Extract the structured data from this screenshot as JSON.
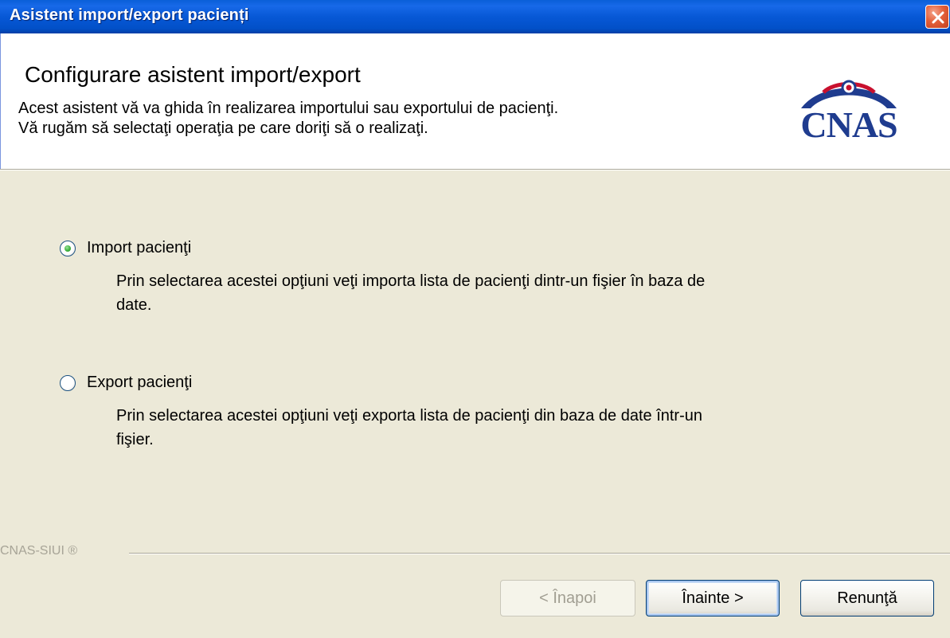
{
  "window": {
    "title": "Asistent import/export pacienți"
  },
  "header": {
    "title": "Configurare asistent import/export",
    "description_lines": [
      "Acest asistent vă va ghida în realizarea importului sau exportului de pacienţi.",
      "Vă rugăm să selectaţi operaţia pe care doriţi să o realizaţi."
    ],
    "logo_text": "CNAS",
    "logo_colors": {
      "text": "#1f3c8f",
      "arc": "#c8102e"
    }
  },
  "options": [
    {
      "label": "Import pacienţi",
      "selected": true,
      "description_lines": [
        "Prin selectarea acestei opţiuni veţi importa lista de pacienţi dintr-un fişier în baza de",
        "date."
      ]
    },
    {
      "label": "Export pacienţi",
      "selected": false,
      "description_lines": [
        "Prin selectarea acestei opţiuni veţi exporta lista de pacienţi din baza de date într-un",
        "fişier."
      ]
    }
  ],
  "footer": {
    "brand": "CNAS-SIUI ®"
  },
  "buttons": {
    "back": {
      "label": "< Înapoi",
      "enabled": false
    },
    "next": {
      "label": "Înainte >",
      "enabled": true,
      "default": true
    },
    "cancel": {
      "label": "Renunţă",
      "enabled": true
    }
  },
  "icons": {
    "close": "close-icon",
    "logo": "cnas-logo"
  }
}
